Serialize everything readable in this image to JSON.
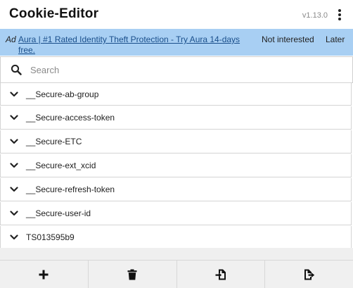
{
  "header": {
    "title": "Cookie-Editor",
    "version": "v1.13.0",
    "menu_icon": "more-vertical-icon"
  },
  "ad": {
    "tag": "Ad",
    "text": "Aura | #1 Rated Identity Theft Protection - Try Aura 14-days free.",
    "not_interested": "Not interested",
    "later": "Later"
  },
  "search": {
    "placeholder": "Search",
    "value": "",
    "icon": "search-icon"
  },
  "cookies": [
    {
      "name": "__Secure-ab-group"
    },
    {
      "name": "__Secure-access-token"
    },
    {
      "name": "__Secure-ETC"
    },
    {
      "name": "__Secure-ext_xcid"
    },
    {
      "name": "__Secure-refresh-token"
    },
    {
      "name": "__Secure-user-id"
    },
    {
      "name": "TS013595b9"
    }
  ],
  "toolbar": {
    "buttons": [
      {
        "icon": "plus-icon"
      },
      {
        "icon": "trash-icon"
      },
      {
        "icon": "import-icon"
      },
      {
        "icon": "export-icon"
      }
    ]
  },
  "colors": {
    "ad_background": "#a8cff3",
    "ad_link": "#1a4f8b",
    "toolbar_background": "#f0f0f0",
    "border": "#d4d4d4"
  }
}
